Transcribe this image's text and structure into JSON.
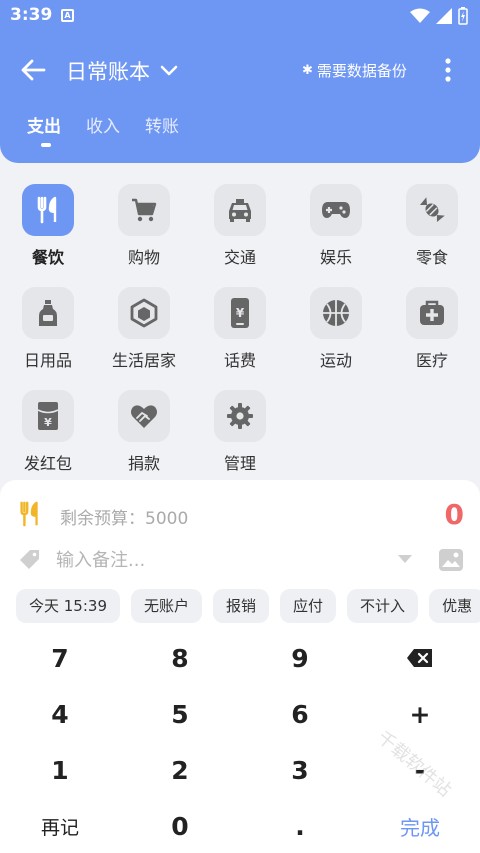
{
  "status": {
    "time": "3:39",
    "notification_badge": "A"
  },
  "header": {
    "book_title": "日常账本",
    "backup_tip": "需要数据备份",
    "tabs": [
      {
        "label": "支出",
        "active": true
      },
      {
        "label": "收入",
        "active": false
      },
      {
        "label": "转账",
        "active": false
      }
    ]
  },
  "categories": [
    {
      "label": "餐饮",
      "icon": "fork-knife-icon",
      "active": true
    },
    {
      "label": "购物",
      "icon": "shopping-cart-icon",
      "active": false
    },
    {
      "label": "交通",
      "icon": "taxi-icon",
      "active": false
    },
    {
      "label": "娱乐",
      "icon": "gamepad-icon",
      "active": false
    },
    {
      "label": "零食",
      "icon": "candy-icon",
      "active": false
    },
    {
      "label": "日用品",
      "icon": "bottle-icon",
      "active": false
    },
    {
      "label": "生活居家",
      "icon": "hexagon-box-icon",
      "active": false
    },
    {
      "label": "话费",
      "icon": "phone-yen-icon",
      "active": false
    },
    {
      "label": "运动",
      "icon": "basketball-icon",
      "active": false
    },
    {
      "label": "医疗",
      "icon": "medical-kit-icon",
      "active": false
    },
    {
      "label": "发红包",
      "icon": "red-envelope-icon",
      "active": false
    },
    {
      "label": "捐款",
      "icon": "heart-hand-icon",
      "active": false
    },
    {
      "label": "管理",
      "icon": "gear-icon",
      "active": false
    }
  ],
  "panel": {
    "budget_text": "剩余预算：5000",
    "amount": "0",
    "note_placeholder": "输入备注...",
    "note_value": ""
  },
  "chips": [
    "今天 15:39",
    "无账户",
    "报销",
    "应付",
    "不计入",
    "优惠"
  ],
  "keypad": {
    "keys": [
      "7",
      "8",
      "9",
      "⌫",
      "4",
      "5",
      "6",
      "+",
      "1",
      "2",
      "3",
      "-",
      "再记",
      "0",
      ".",
      "完成"
    ]
  },
  "colors": {
    "accent": "#6e96f3",
    "amount": "#ef6767",
    "icon_gray": "#666666"
  },
  "watermark": "千载软件站"
}
